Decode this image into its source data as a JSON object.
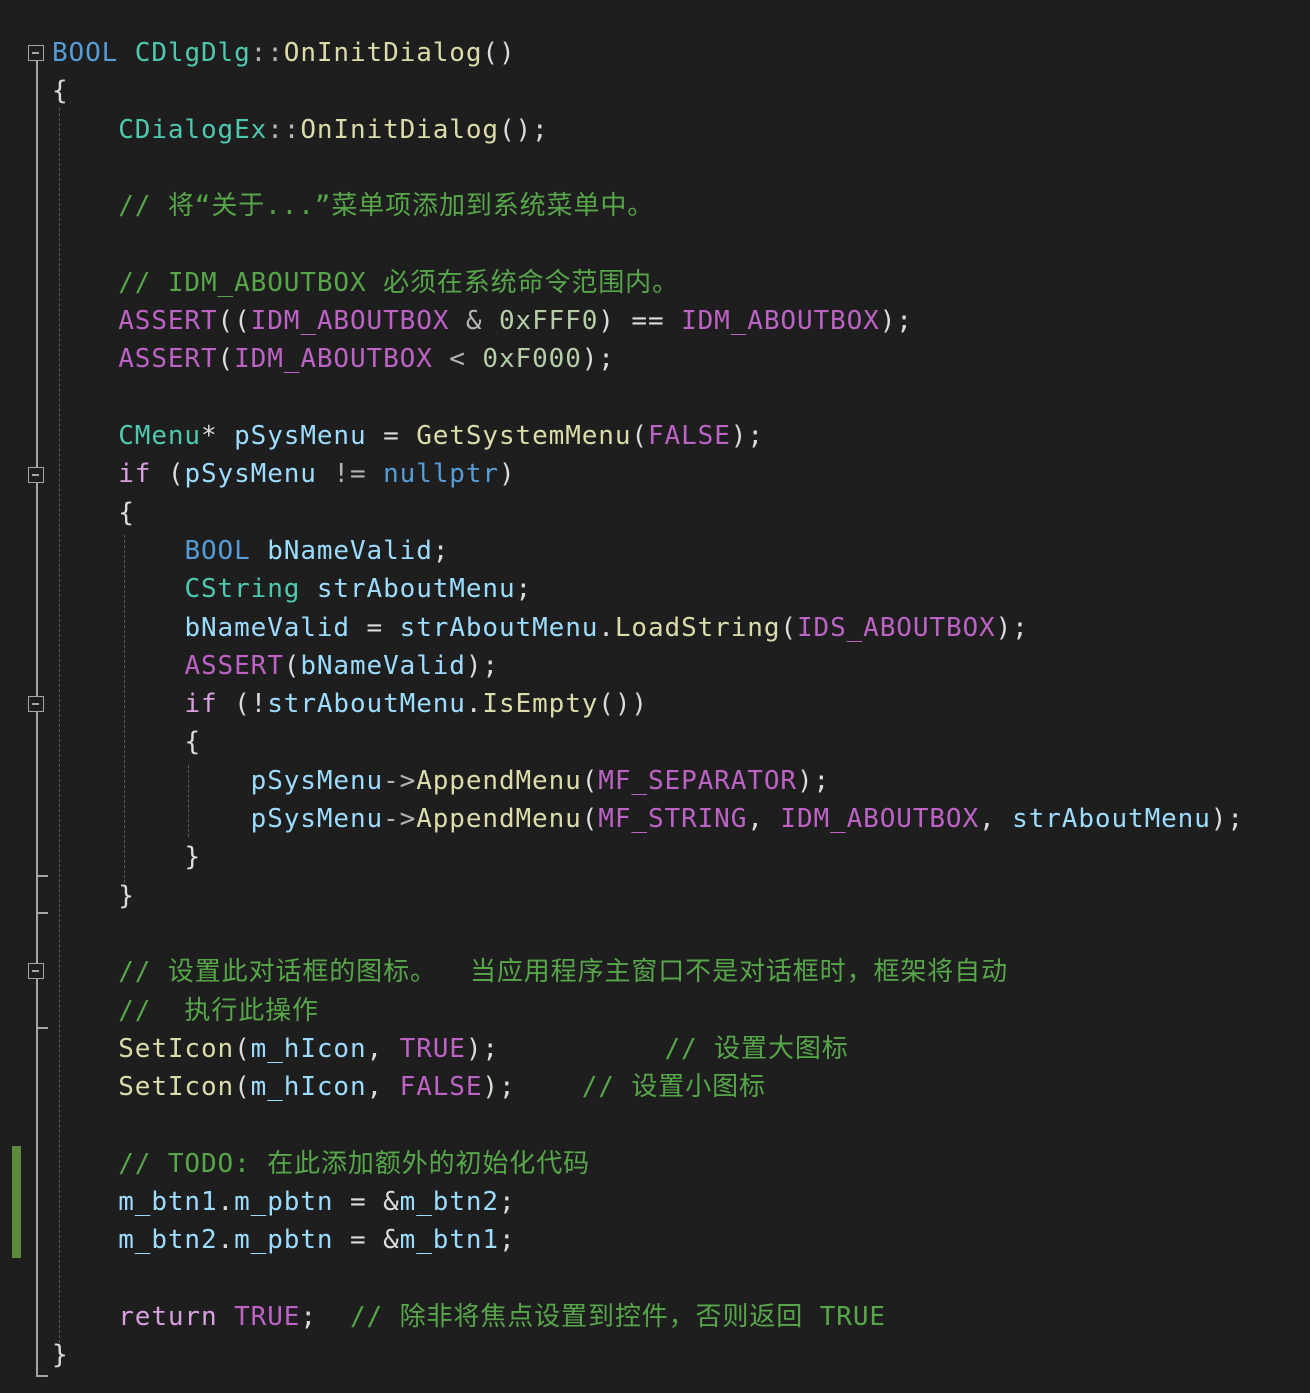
{
  "code": {
    "lines": [
      [
        [
          "BOOL",
          "kw"
        ],
        [
          " ",
          "plain"
        ],
        [
          "CDlgDlg",
          "type"
        ],
        [
          "::",
          "op"
        ],
        [
          "OnInitDialog",
          "fn"
        ],
        [
          "()",
          "plain"
        ]
      ],
      [
        [
          "{",
          "plain"
        ]
      ],
      [
        [
          "    ",
          "plain"
        ],
        [
          "CDialogEx",
          "type"
        ],
        [
          "::",
          "op"
        ],
        [
          "OnInitDialog",
          "fn"
        ],
        [
          "();",
          "plain"
        ]
      ],
      [],
      [
        [
          "    ",
          "plain"
        ],
        [
          "// 将“关于...”菜单项添加到系统菜单中。",
          "cmt"
        ]
      ],
      [],
      [
        [
          "    ",
          "plain"
        ],
        [
          "// IDM_ABOUTBOX 必须在系统命令范围内。",
          "cmt"
        ]
      ],
      [
        [
          "    ",
          "plain"
        ],
        [
          "ASSERT",
          "mac"
        ],
        [
          "((",
          "plain"
        ],
        [
          "IDM_ABOUTBOX",
          "mac"
        ],
        [
          " & ",
          "op"
        ],
        [
          "0xFFF0",
          "num"
        ],
        [
          ") == ",
          "plain"
        ],
        [
          "IDM_ABOUTBOX",
          "mac"
        ],
        [
          ");",
          "plain"
        ]
      ],
      [
        [
          "    ",
          "plain"
        ],
        [
          "ASSERT",
          "mac"
        ],
        [
          "(",
          "plain"
        ],
        [
          "IDM_ABOUTBOX",
          "mac"
        ],
        [
          " < ",
          "op"
        ],
        [
          "0xF000",
          "num"
        ],
        [
          ");",
          "plain"
        ]
      ],
      [],
      [
        [
          "    ",
          "plain"
        ],
        [
          "CMenu",
          "type"
        ],
        [
          "* ",
          "plain"
        ],
        [
          "pSysMenu",
          "var"
        ],
        [
          " = ",
          "plain"
        ],
        [
          "GetSystemMenu",
          "fn"
        ],
        [
          "(",
          "plain"
        ],
        [
          "FALSE",
          "mac"
        ],
        [
          ");",
          "plain"
        ]
      ],
      [
        [
          "    ",
          "plain"
        ],
        [
          "if",
          "ctl"
        ],
        [
          " (",
          "plain"
        ],
        [
          "pSysMenu",
          "var"
        ],
        [
          " != ",
          "op"
        ],
        [
          "nullptr",
          "kw"
        ],
        [
          ")",
          "plain"
        ]
      ],
      [
        [
          "    ",
          "plain"
        ],
        [
          "{",
          "plain"
        ]
      ],
      [
        [
          "        ",
          "plain"
        ],
        [
          "BOOL",
          "kw"
        ],
        [
          " ",
          "plain"
        ],
        [
          "bNameValid",
          "var"
        ],
        [
          ";",
          "plain"
        ]
      ],
      [
        [
          "        ",
          "plain"
        ],
        [
          "CString",
          "type"
        ],
        [
          " ",
          "plain"
        ],
        [
          "strAboutMenu",
          "var"
        ],
        [
          ";",
          "plain"
        ]
      ],
      [
        [
          "        ",
          "plain"
        ],
        [
          "bNameValid",
          "var"
        ],
        [
          " = ",
          "plain"
        ],
        [
          "strAboutMenu",
          "var"
        ],
        [
          ".",
          "plain"
        ],
        [
          "LoadString",
          "fn"
        ],
        [
          "(",
          "plain"
        ],
        [
          "IDS_ABOUTBOX",
          "mac"
        ],
        [
          ");",
          "plain"
        ]
      ],
      [
        [
          "        ",
          "plain"
        ],
        [
          "ASSERT",
          "mac"
        ],
        [
          "(",
          "plain"
        ],
        [
          "bNameValid",
          "var"
        ],
        [
          ");",
          "plain"
        ]
      ],
      [
        [
          "        ",
          "plain"
        ],
        [
          "if",
          "ctl"
        ],
        [
          " (!",
          "plain"
        ],
        [
          "strAboutMenu",
          "var"
        ],
        [
          ".",
          "plain"
        ],
        [
          "IsEmpty",
          "fn"
        ],
        [
          "())",
          "plain"
        ]
      ],
      [
        [
          "        ",
          "plain"
        ],
        [
          "{",
          "plain"
        ]
      ],
      [
        [
          "            ",
          "plain"
        ],
        [
          "pSysMenu",
          "var"
        ],
        [
          "->",
          "op"
        ],
        [
          "AppendMenu",
          "fn"
        ],
        [
          "(",
          "plain"
        ],
        [
          "MF_SEPARATOR",
          "mac"
        ],
        [
          ");",
          "plain"
        ]
      ],
      [
        [
          "            ",
          "plain"
        ],
        [
          "pSysMenu",
          "var"
        ],
        [
          "->",
          "op"
        ],
        [
          "AppendMenu",
          "fn"
        ],
        [
          "(",
          "plain"
        ],
        [
          "MF_STRING",
          "mac"
        ],
        [
          ", ",
          "plain"
        ],
        [
          "IDM_ABOUTBOX",
          "mac"
        ],
        [
          ", ",
          "plain"
        ],
        [
          "strAboutMenu",
          "var"
        ],
        [
          ");",
          "plain"
        ]
      ],
      [
        [
          "        ",
          "plain"
        ],
        [
          "}",
          "plain"
        ]
      ],
      [
        [
          "    ",
          "plain"
        ],
        [
          "}",
          "plain"
        ]
      ],
      [],
      [
        [
          "    ",
          "plain"
        ],
        [
          "// 设置此对话框的图标。  当应用程序主窗口不是对话框时，框架将自动",
          "cmt"
        ]
      ],
      [
        [
          "    ",
          "plain"
        ],
        [
          "//  执行此操作",
          "cmt"
        ]
      ],
      [
        [
          "    ",
          "plain"
        ],
        [
          "SetIcon",
          "fn"
        ],
        [
          "(",
          "plain"
        ],
        [
          "m_hIcon",
          "var"
        ],
        [
          ", ",
          "plain"
        ],
        [
          "TRUE",
          "mac"
        ],
        [
          ");          ",
          "plain"
        ],
        [
          "// 设置大图标",
          "cmt"
        ]
      ],
      [
        [
          "    ",
          "plain"
        ],
        [
          "SetIcon",
          "fn"
        ],
        [
          "(",
          "plain"
        ],
        [
          "m_hIcon",
          "var"
        ],
        [
          ", ",
          "plain"
        ],
        [
          "FALSE",
          "mac"
        ],
        [
          ");    ",
          "plain"
        ],
        [
          "// 设置小图标",
          "cmt"
        ]
      ],
      [],
      [
        [
          "    ",
          "plain"
        ],
        [
          "// TODO: 在此添加额外的初始化代码",
          "cmt"
        ]
      ],
      [
        [
          "    ",
          "plain"
        ],
        [
          "m_btn1",
          "var"
        ],
        [
          ".",
          "plain"
        ],
        [
          "m_pbtn",
          "var"
        ],
        [
          " = &",
          "plain"
        ],
        [
          "m_btn2",
          "var"
        ],
        [
          ";",
          "plain"
        ]
      ],
      [
        [
          "    ",
          "plain"
        ],
        [
          "m_btn2",
          "var"
        ],
        [
          ".",
          "plain"
        ],
        [
          "m_pbtn",
          "var"
        ],
        [
          " = &",
          "plain"
        ],
        [
          "m_btn1",
          "var"
        ],
        [
          ";",
          "plain"
        ]
      ],
      [],
      [
        [
          "    ",
          "plain"
        ],
        [
          "return",
          "ctl"
        ],
        [
          " ",
          "plain"
        ],
        [
          "TRUE",
          "mac"
        ],
        [
          ";  ",
          "plain"
        ],
        [
          "// 除非将焦点设置到控件，否则返回 TRUE",
          "cmt"
        ]
      ],
      [
        [
          "}",
          "plain"
        ]
      ]
    ]
  },
  "colors": {
    "background": "#1e1e1e",
    "keyword": "#569cd6",
    "type": "#4ec9b0",
    "function": "#dcdcaa",
    "variable": "#9cdcfe",
    "macro": "#bd63c5",
    "comment": "#57a64a",
    "change_marker": "#5a8a3a"
  }
}
